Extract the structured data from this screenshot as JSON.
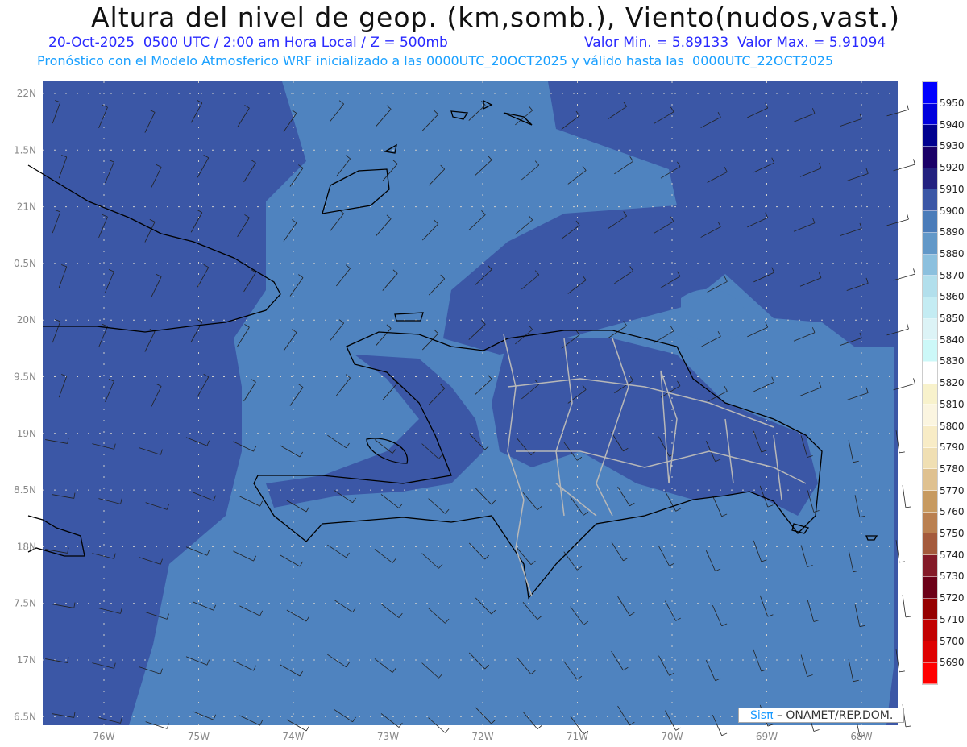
{
  "header": {
    "title": "Altura del nivel de geop. (km,somb.), Viento(nudos,vast.)",
    "subtitle_left": "20-Oct-2025  0500 UTC / 2:00 am Hora Local / Z = 500mb",
    "subtitle_right": "Valor Min. = 5.89133  Valor Max. = 5.91094",
    "forecast_line": "Pronóstico con el Modelo Atmosferico WRF inicializado a las 0000UTC_20OCT2025 y válido hasta las  0000UTC_22OCT2025"
  },
  "map": {
    "lon_labels": [
      "76W",
      "75W",
      "74W",
      "73W",
      "72W",
      "71W",
      "70W",
      "69W",
      "68W"
    ],
    "lat_labels": [
      "22N",
      "1.5N",
      "21N",
      "0.5N",
      "20N",
      "9.5N",
      "19N",
      "8.5N",
      "18N",
      "7.5N",
      "17N",
      "6.5N"
    ],
    "colors": {
      "dark": "#3b57a6",
      "light": "#4f83bf",
      "coast": "#000000",
      "provinces": "#b8b8b8"
    }
  },
  "colorbar": {
    "labels": [
      "5950",
      "5940",
      "5930",
      "5920",
      "5910",
      "5900",
      "5890",
      "5880",
      "5870",
      "5860",
      "5850",
      "5840",
      "5830",
      "5820",
      "5810",
      "5800",
      "5790",
      "5780",
      "5770",
      "5760",
      "5750",
      "5740",
      "5730",
      "5720",
      "5710",
      "5700",
      "5690"
    ],
    "colors": [
      "#0000ff",
      "#0000dd",
      "#00008f",
      "#1a0068",
      "#23217f",
      "#3b57a6",
      "#4a7cb9",
      "#6298c8",
      "#8cc0de",
      "#b2dfec",
      "#c4ecf3",
      "#dcf3f6",
      "#ccf8f8",
      "#ffffff",
      "#f8f2cc",
      "#fbf5e0",
      "#f8ecc6",
      "#f0dfb3",
      "#dfc190",
      "#c79a60",
      "#ba8050",
      "#a45a3c",
      "#841a28",
      "#6c0018",
      "#960000",
      "#c20000",
      "#de0000",
      "#ff0000"
    ]
  },
  "credit": {
    "logo": "Sisπ",
    "text": " – ONAMET/REP.DOM."
  }
}
